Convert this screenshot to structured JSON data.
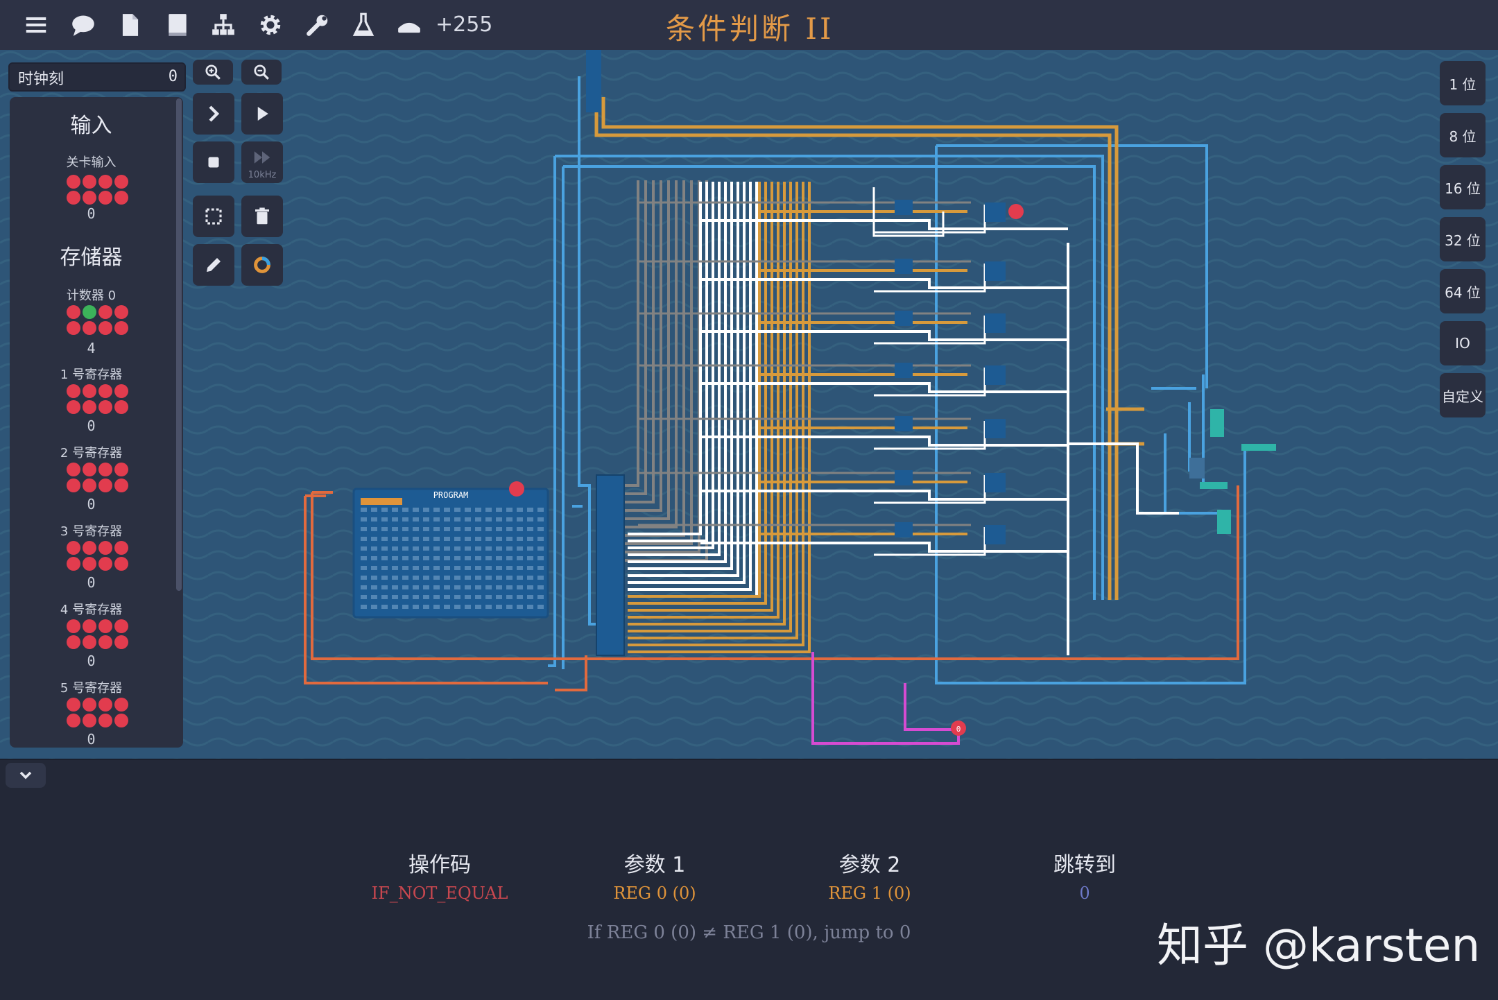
{
  "toolbar": {
    "icons": [
      "menu-icon",
      "chat-icon",
      "document-icon",
      "book-icon",
      "hierarchy-icon",
      "gear-icon",
      "wrench-icon",
      "flask-icon",
      "hat-icon"
    ],
    "score": "+255"
  },
  "level": {
    "title": "条件判断 II"
  },
  "left_panel": {
    "search_value": "时钟刻",
    "search_count": "0",
    "sections": {
      "input_header": "输入",
      "level_input": {
        "label": "关卡输入",
        "value": "0"
      },
      "storage_header": "存储器",
      "counter": {
        "label": "计数器 0",
        "value": "4"
      },
      "registers": [
        {
          "label": "1 号寄存器",
          "value": "0"
        },
        {
          "label": "2 号寄存器",
          "value": "0"
        },
        {
          "label": "3 号寄存器",
          "value": "0"
        },
        {
          "label": "4 号寄存器",
          "value": "0"
        },
        {
          "label": "5 号寄存器",
          "value": "0"
        }
      ]
    }
  },
  "tools": {
    "zoom_in": "zoom-in-icon",
    "zoom_out": "zoom-out-icon",
    "fast_forward_label": "10kHz"
  },
  "right_panel": {
    "buttons": [
      "1 位",
      "8 位",
      "16 位",
      "32 位",
      "64 位",
      "IO",
      "自定义"
    ]
  },
  "circuit": {
    "program_label": "PROGRAM",
    "output_value": "0"
  },
  "instruction": {
    "opcode_header": "操作码",
    "opcode_value": "IF_NOT_EQUAL",
    "arg1_header": "参数 1",
    "arg1_value": "REG 0 (0)",
    "arg2_header": "参数 2",
    "arg2_value": "REG 1 (0)",
    "jump_header": "跳转到",
    "jump_value": "0",
    "description": "If REG 0 (0) ≠ REG 1 (0), jump to 0"
  },
  "colors": {
    "opcode": "#c8474f",
    "arg": "#e0943a",
    "jump": "#6e79c9",
    "wire_orange": "#d79a3c",
    "wire_blue": "#4aa2e0",
    "wire_white": "#ffffff",
    "wire_gray": "#7a7a7a",
    "wire_red": "#e26a3e",
    "wire_pink": "#d64bd2"
  },
  "watermark": "知乎 @karsten"
}
